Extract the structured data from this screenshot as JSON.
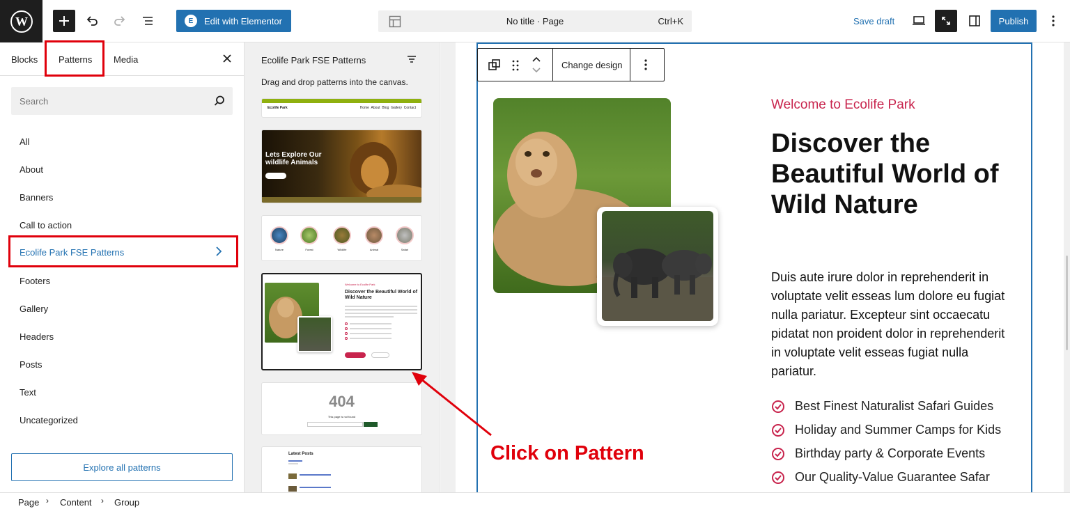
{
  "topbar": {
    "edit_elementor": "Edit with Elementor",
    "elementor_icon": "E",
    "doc_title": "No title · Page",
    "shortcut": "Ctrl+K",
    "save_draft": "Save draft",
    "publish": "Publish",
    "icons": [
      "wordpress-logo",
      "add-block-icon",
      "undo-icon",
      "redo-icon",
      "document-overview-icon",
      "layout-icon",
      "desktop-view-icon",
      "zoom-out-icon",
      "settings-sidebar-icon",
      "options-icon"
    ]
  },
  "inserter": {
    "tabs": [
      "Blocks",
      "Patterns",
      "Media"
    ],
    "active_tab": "Patterns",
    "search_placeholder": "Search",
    "categories": [
      "All",
      "About",
      "Banners",
      "Call to action",
      "Ecolife Park FSE Patterns",
      "Footers",
      "Gallery",
      "Headers",
      "Posts",
      "Text",
      "Uncategorized"
    ],
    "active_category": "Ecolife Park FSE Patterns",
    "explore_button": "Explore all patterns"
  },
  "pattern_list": {
    "title": "Ecolife Park FSE Patterns",
    "description": "Drag and drop patterns into the canvas.",
    "header_thumb": {
      "brand": "Ecolife Park",
      "nav": [
        "Home",
        "About",
        "Blog",
        "Gallery",
        "Contact"
      ]
    },
    "banner_thumb": {
      "headline": "Lets Explore Our wildlife Animals"
    },
    "circles_thumb": {
      "labels": [
        "Nature",
        "Forest",
        "Wildlife",
        "Animal",
        "Safari"
      ]
    },
    "about_thumb": {
      "welcome": "Welcome to Ecolife Park",
      "headline": "Discover the Beautiful World of Wild Nature"
    },
    "notfound_thumb": {
      "code": "404",
      "message": "This page is not found"
    },
    "posts_thumb": {
      "title": "Latest Posts"
    }
  },
  "canvas": {
    "block_toolbar": {
      "change_design": "Change design"
    },
    "welcome": "Welcome to Ecolife Park",
    "headline": "Discover the Beautiful World of Wild Nature",
    "paragraph": "Duis aute irure dolor in reprehenderit in voluptate velit esseas lum dolore eu fugiat nulla pariatur. Excepteur sint occaecatu pidatat non proident dolor in reprehenderit in voluptate velit esseas fugiat nulla pariatur.",
    "features": [
      "Best Finest Naturalist Safari Guides",
      "Holiday and Summer Camps for Kids",
      "Birthday party & Corporate Events",
      "Our Quality-Value Guarantee Safar"
    ],
    "annotation": "Click on Pattern",
    "accent_color": "#c8244d",
    "annotation_color": "#e0000b"
  },
  "breadcrumb": [
    "Page",
    "Content",
    "Group"
  ]
}
